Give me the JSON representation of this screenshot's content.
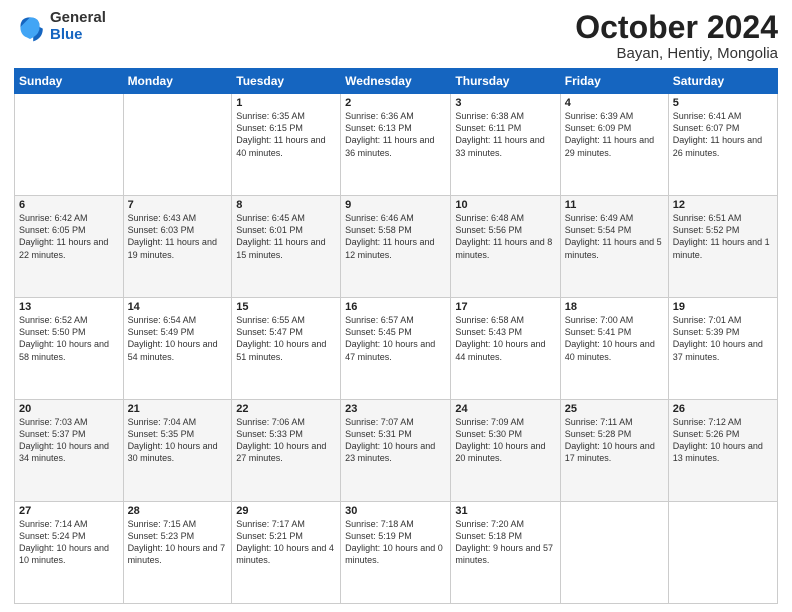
{
  "logo": {
    "general": "General",
    "blue": "Blue"
  },
  "header": {
    "month": "October 2024",
    "location": "Bayan, Hentiy, Mongolia"
  },
  "weekdays": [
    "Sunday",
    "Monday",
    "Tuesday",
    "Wednesday",
    "Thursday",
    "Friday",
    "Saturday"
  ],
  "weeks": [
    [
      {
        "day": "",
        "content": ""
      },
      {
        "day": "",
        "content": ""
      },
      {
        "day": "1",
        "content": "Sunrise: 6:35 AM\nSunset: 6:15 PM\nDaylight: 11 hours and 40 minutes."
      },
      {
        "day": "2",
        "content": "Sunrise: 6:36 AM\nSunset: 6:13 PM\nDaylight: 11 hours and 36 minutes."
      },
      {
        "day": "3",
        "content": "Sunrise: 6:38 AM\nSunset: 6:11 PM\nDaylight: 11 hours and 33 minutes."
      },
      {
        "day": "4",
        "content": "Sunrise: 6:39 AM\nSunset: 6:09 PM\nDaylight: 11 hours and 29 minutes."
      },
      {
        "day": "5",
        "content": "Sunrise: 6:41 AM\nSunset: 6:07 PM\nDaylight: 11 hours and 26 minutes."
      }
    ],
    [
      {
        "day": "6",
        "content": "Sunrise: 6:42 AM\nSunset: 6:05 PM\nDaylight: 11 hours and 22 minutes."
      },
      {
        "day": "7",
        "content": "Sunrise: 6:43 AM\nSunset: 6:03 PM\nDaylight: 11 hours and 19 minutes."
      },
      {
        "day": "8",
        "content": "Sunrise: 6:45 AM\nSunset: 6:01 PM\nDaylight: 11 hours and 15 minutes."
      },
      {
        "day": "9",
        "content": "Sunrise: 6:46 AM\nSunset: 5:58 PM\nDaylight: 11 hours and 12 minutes."
      },
      {
        "day": "10",
        "content": "Sunrise: 6:48 AM\nSunset: 5:56 PM\nDaylight: 11 hours and 8 minutes."
      },
      {
        "day": "11",
        "content": "Sunrise: 6:49 AM\nSunset: 5:54 PM\nDaylight: 11 hours and 5 minutes."
      },
      {
        "day": "12",
        "content": "Sunrise: 6:51 AM\nSunset: 5:52 PM\nDaylight: 11 hours and 1 minute."
      }
    ],
    [
      {
        "day": "13",
        "content": "Sunrise: 6:52 AM\nSunset: 5:50 PM\nDaylight: 10 hours and 58 minutes."
      },
      {
        "day": "14",
        "content": "Sunrise: 6:54 AM\nSunset: 5:49 PM\nDaylight: 10 hours and 54 minutes."
      },
      {
        "day": "15",
        "content": "Sunrise: 6:55 AM\nSunset: 5:47 PM\nDaylight: 10 hours and 51 minutes."
      },
      {
        "day": "16",
        "content": "Sunrise: 6:57 AM\nSunset: 5:45 PM\nDaylight: 10 hours and 47 minutes."
      },
      {
        "day": "17",
        "content": "Sunrise: 6:58 AM\nSunset: 5:43 PM\nDaylight: 10 hours and 44 minutes."
      },
      {
        "day": "18",
        "content": "Sunrise: 7:00 AM\nSunset: 5:41 PM\nDaylight: 10 hours and 40 minutes."
      },
      {
        "day": "19",
        "content": "Sunrise: 7:01 AM\nSunset: 5:39 PM\nDaylight: 10 hours and 37 minutes."
      }
    ],
    [
      {
        "day": "20",
        "content": "Sunrise: 7:03 AM\nSunset: 5:37 PM\nDaylight: 10 hours and 34 minutes."
      },
      {
        "day": "21",
        "content": "Sunrise: 7:04 AM\nSunset: 5:35 PM\nDaylight: 10 hours and 30 minutes."
      },
      {
        "day": "22",
        "content": "Sunrise: 7:06 AM\nSunset: 5:33 PM\nDaylight: 10 hours and 27 minutes."
      },
      {
        "day": "23",
        "content": "Sunrise: 7:07 AM\nSunset: 5:31 PM\nDaylight: 10 hours and 23 minutes."
      },
      {
        "day": "24",
        "content": "Sunrise: 7:09 AM\nSunset: 5:30 PM\nDaylight: 10 hours and 20 minutes."
      },
      {
        "day": "25",
        "content": "Sunrise: 7:11 AM\nSunset: 5:28 PM\nDaylight: 10 hours and 17 minutes."
      },
      {
        "day": "26",
        "content": "Sunrise: 7:12 AM\nSunset: 5:26 PM\nDaylight: 10 hours and 13 minutes."
      }
    ],
    [
      {
        "day": "27",
        "content": "Sunrise: 7:14 AM\nSunset: 5:24 PM\nDaylight: 10 hours and 10 minutes."
      },
      {
        "day": "28",
        "content": "Sunrise: 7:15 AM\nSunset: 5:23 PM\nDaylight: 10 hours and 7 minutes."
      },
      {
        "day": "29",
        "content": "Sunrise: 7:17 AM\nSunset: 5:21 PM\nDaylight: 10 hours and 4 minutes."
      },
      {
        "day": "30",
        "content": "Sunrise: 7:18 AM\nSunset: 5:19 PM\nDaylight: 10 hours and 0 minutes."
      },
      {
        "day": "31",
        "content": "Sunrise: 7:20 AM\nSunset: 5:18 PM\nDaylight: 9 hours and 57 minutes."
      },
      {
        "day": "",
        "content": ""
      },
      {
        "day": "",
        "content": ""
      }
    ]
  ]
}
